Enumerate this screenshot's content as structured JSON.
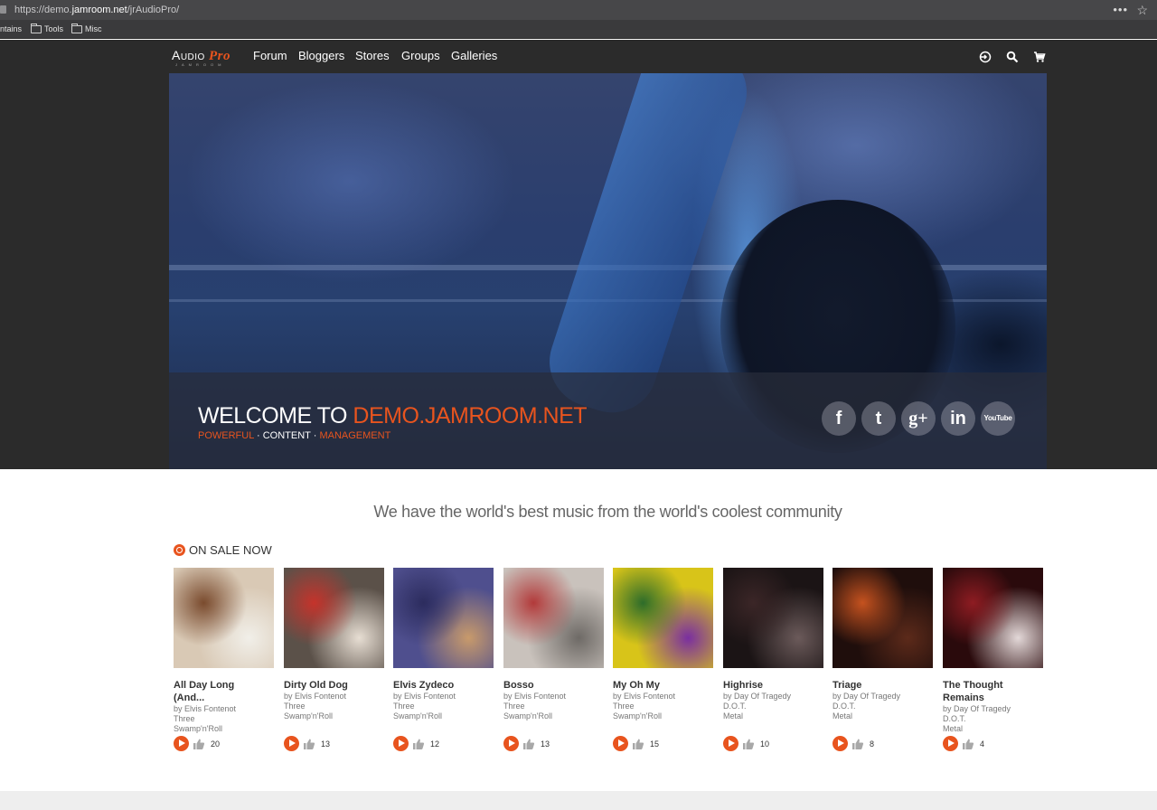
{
  "browser": {
    "url_prefix": "https://demo.",
    "url_domain": "jamroom.net",
    "url_path": "/jrAudioPro/",
    "menu_glyph": "•••",
    "bookmark_icon": "star-icon",
    "bookmarks": [
      {
        "label": "ntains"
      },
      {
        "label": "Tools"
      },
      {
        "label": "Misc"
      }
    ]
  },
  "site": {
    "logo_main": "Audio",
    "logo_pro": "Pro",
    "logo_tag": "JAMROOM",
    "nav": [
      "Forum",
      "Bloggers",
      "Stores",
      "Groups",
      "Galleries"
    ],
    "header_icons": [
      "login-icon",
      "search-icon",
      "cart-icon"
    ]
  },
  "hero": {
    "welcome_prefix": "WELCOME TO ",
    "welcome_site": "DEMO.JAMROOM.NET",
    "sub_1": "POWERFUL",
    "sub_sep": " · ",
    "sub_2": "CONTENT",
    "sub_3": "MANAGEMENT",
    "social": [
      {
        "icon": "facebook-icon",
        "glyph": "f"
      },
      {
        "icon": "twitter-icon",
        "glyph": "t"
      },
      {
        "icon": "google-plus-icon",
        "glyph": "g+"
      },
      {
        "icon": "linkedin-icon",
        "glyph": "in"
      },
      {
        "icon": "youtube-icon",
        "glyph": "YouTube"
      }
    ]
  },
  "content": {
    "tagline": "We have the world's best music from the world's coolest community",
    "section_title": "ON SALE NOW",
    "items": [
      {
        "title": "All Day Long (And...",
        "artist": "by Elvis Fontenot",
        "album": "Three",
        "genre": "Swamp'n'Roll",
        "likes": "20",
        "palette": [
          "#d9c9b5",
          "#7a4b2e",
          "#f1efe9"
        ]
      },
      {
        "title": "Dirty Old Dog",
        "artist": "by Elvis Fontenot",
        "album": "Three",
        "genre": "Swamp'n'Roll",
        "likes": "13",
        "palette": [
          "#5b5149",
          "#c5332b",
          "#e7ded3"
        ]
      },
      {
        "title": "Elvis Zydeco",
        "artist": "by Elvis Fontenot",
        "album": "Three",
        "genre": "Swamp'n'Roll",
        "likes": "12",
        "palette": [
          "#4f4f8e",
          "#2c2c5e",
          "#c89a6b"
        ]
      },
      {
        "title": "Bosso",
        "artist": "by Elvis Fontenot",
        "album": "Three",
        "genre": "Swamp'n'Roll",
        "likes": "13",
        "palette": [
          "#c9c2bc",
          "#b23a3a",
          "#6e6a66"
        ]
      },
      {
        "title": "My Oh My",
        "artist": "by Elvis Fontenot",
        "album": "Three",
        "genre": "Swamp'n'Roll",
        "likes": "15",
        "palette": [
          "#d8c419",
          "#2d6c2a",
          "#7a2fa0"
        ]
      },
      {
        "title": "Highrise",
        "artist": "by Day Of Tragedy",
        "album": "D.O.T.",
        "genre": "Metal",
        "likes": "10",
        "palette": [
          "#1b1415",
          "#3b2627",
          "#6b5a5a"
        ]
      },
      {
        "title": "Triage",
        "artist": "by Day Of Tragedy",
        "album": "D.O.T.",
        "genre": "Metal",
        "likes": "8",
        "palette": [
          "#1f0e0c",
          "#c5521f",
          "#5c2a1a"
        ]
      },
      {
        "title": "The Thought Remains",
        "artist": "by Day Of Tragedy",
        "album": "D.O.T.",
        "genre": "Metal",
        "likes": "4",
        "palette": [
          "#2a0a0c",
          "#8e1c22",
          "#e3d8d8"
        ]
      }
    ]
  },
  "colors": {
    "accent": "#e8541e",
    "dark": "#2b2b2b"
  }
}
